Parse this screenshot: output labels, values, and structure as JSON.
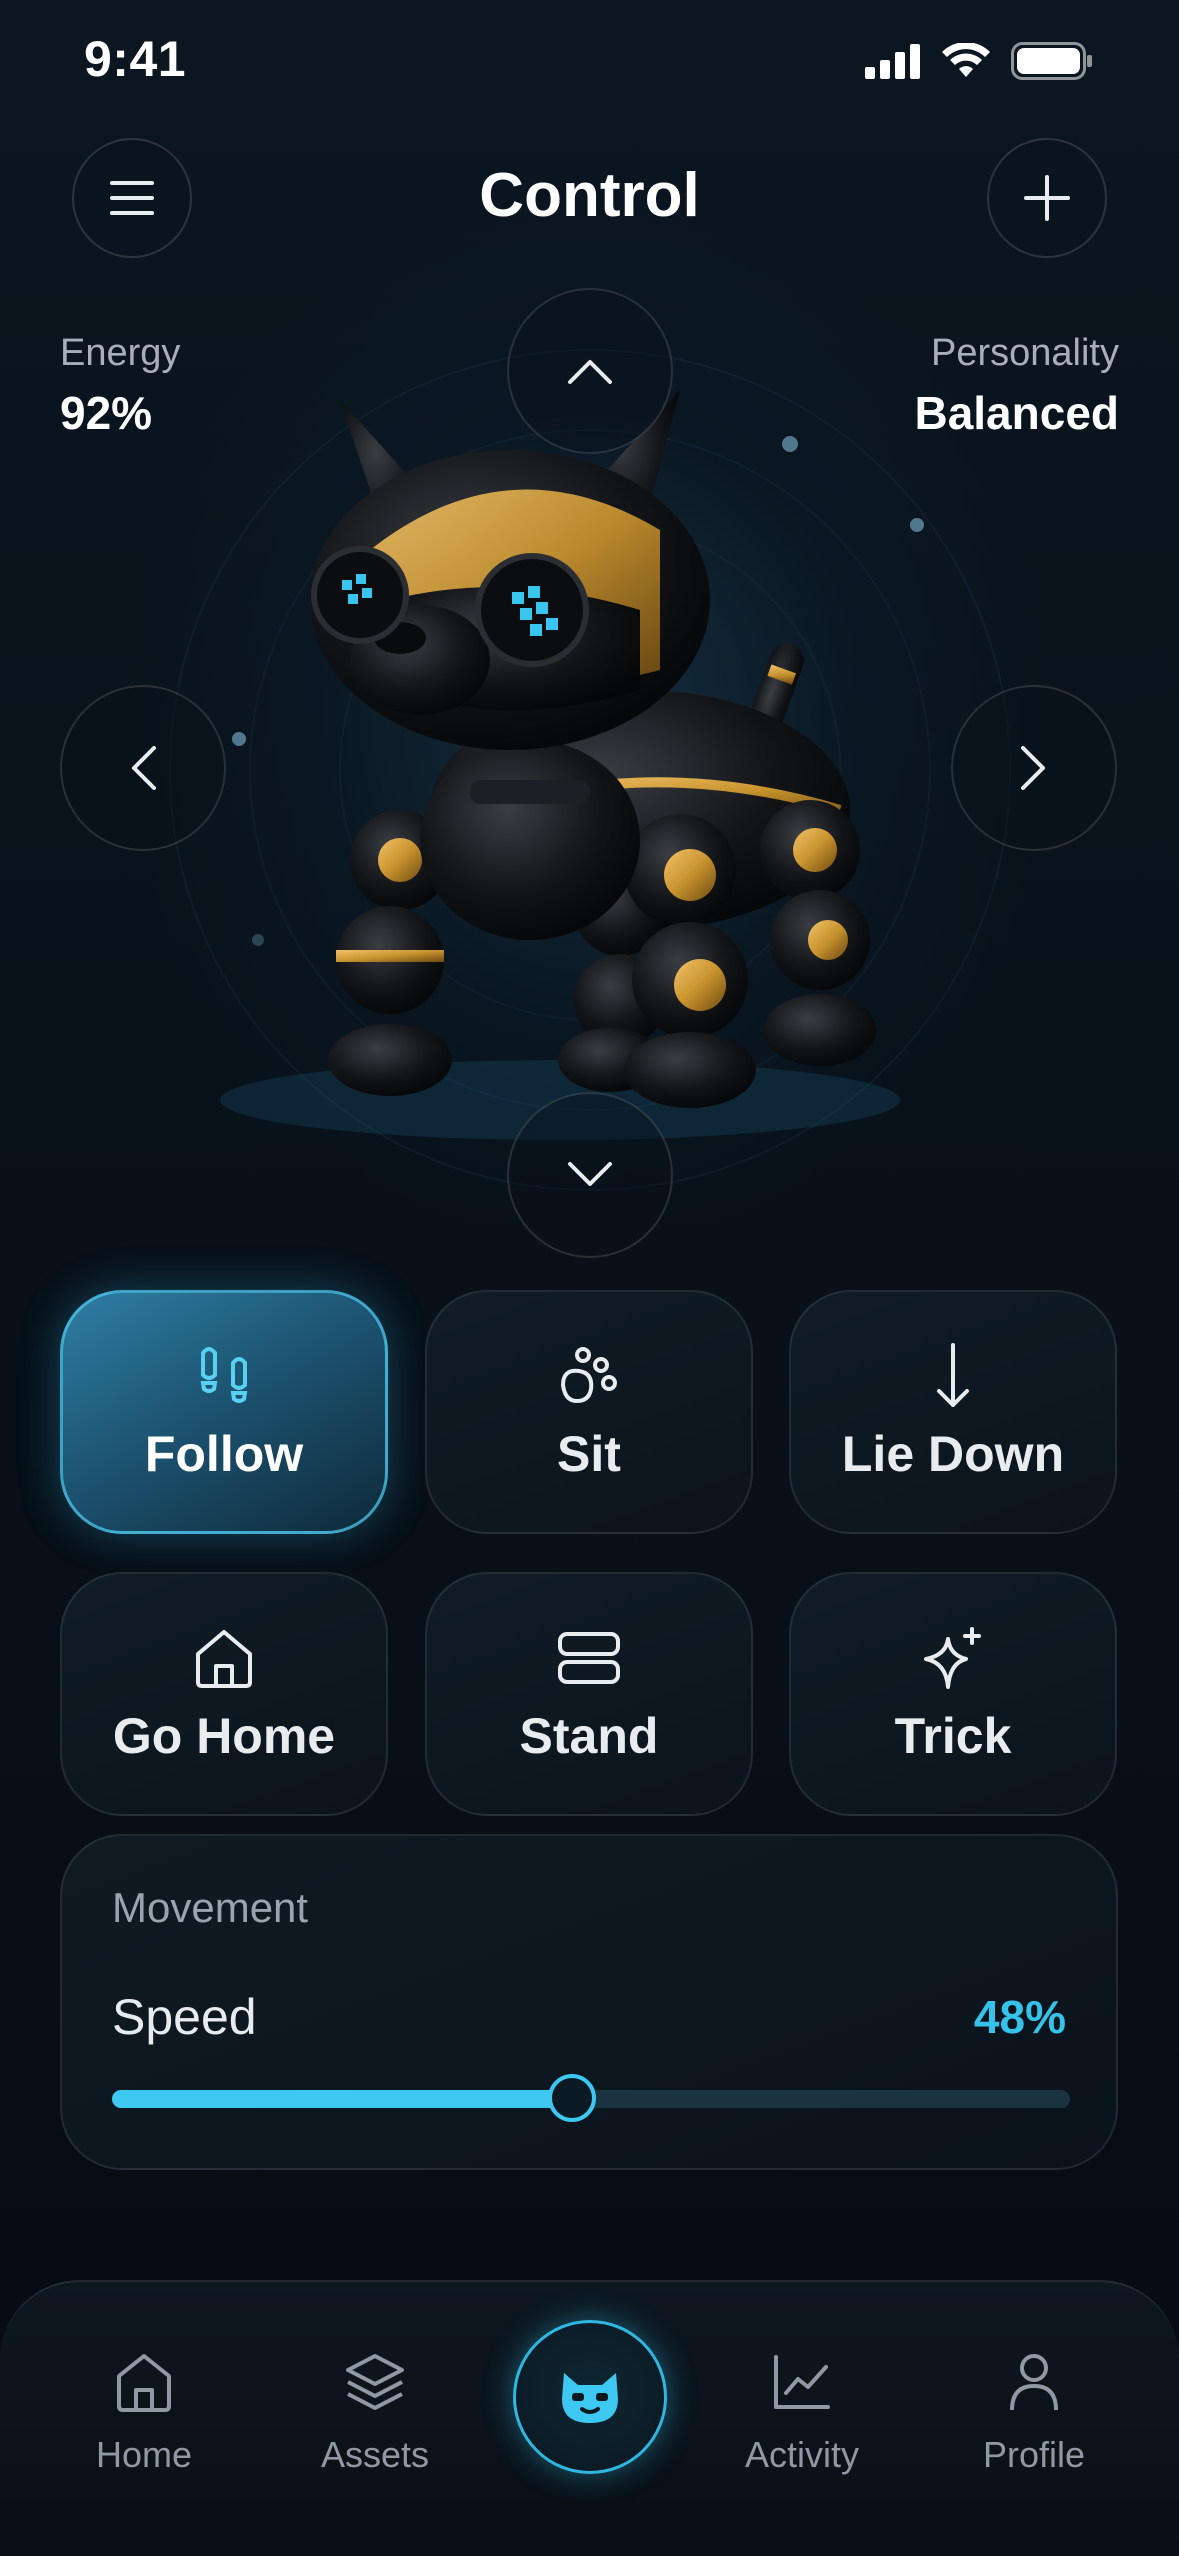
{
  "status_bar": {
    "time": "9:41"
  },
  "header": {
    "title": "Control"
  },
  "stats": {
    "energy_label": "Energy",
    "energy_value": "92%",
    "personality_label": "Personality",
    "personality_value": "Balanced"
  },
  "commands": [
    {
      "label": "Follow",
      "icon": "footprints-icon",
      "active": true
    },
    {
      "label": "Sit",
      "icon": "paw-icon",
      "active": false
    },
    {
      "label": "Lie Down",
      "icon": "arrow-down-icon",
      "active": false
    },
    {
      "label": "Go Home",
      "icon": "home-icon",
      "active": false
    },
    {
      "label": "Stand",
      "icon": "stand-icon",
      "active": false
    },
    {
      "label": "Trick",
      "icon": "sparkle-icon",
      "active": false
    }
  ],
  "movement": {
    "title": "Movement",
    "speed_label": "Speed",
    "speed_text": "48%",
    "speed_fraction": 0.48
  },
  "nav": {
    "items": [
      {
        "label": "Home",
        "icon": "home-icon"
      },
      {
        "label": "Assets",
        "icon": "layers-icon"
      },
      {
        "label": "Activity",
        "icon": "chart-icon"
      },
      {
        "label": "Profile",
        "icon": "user-icon"
      }
    ],
    "center_icon": "robot-cat-icon"
  },
  "colors": {
    "accent": "#3cc8f0",
    "background": "#060b12",
    "robot_gold": "#c8932e"
  }
}
